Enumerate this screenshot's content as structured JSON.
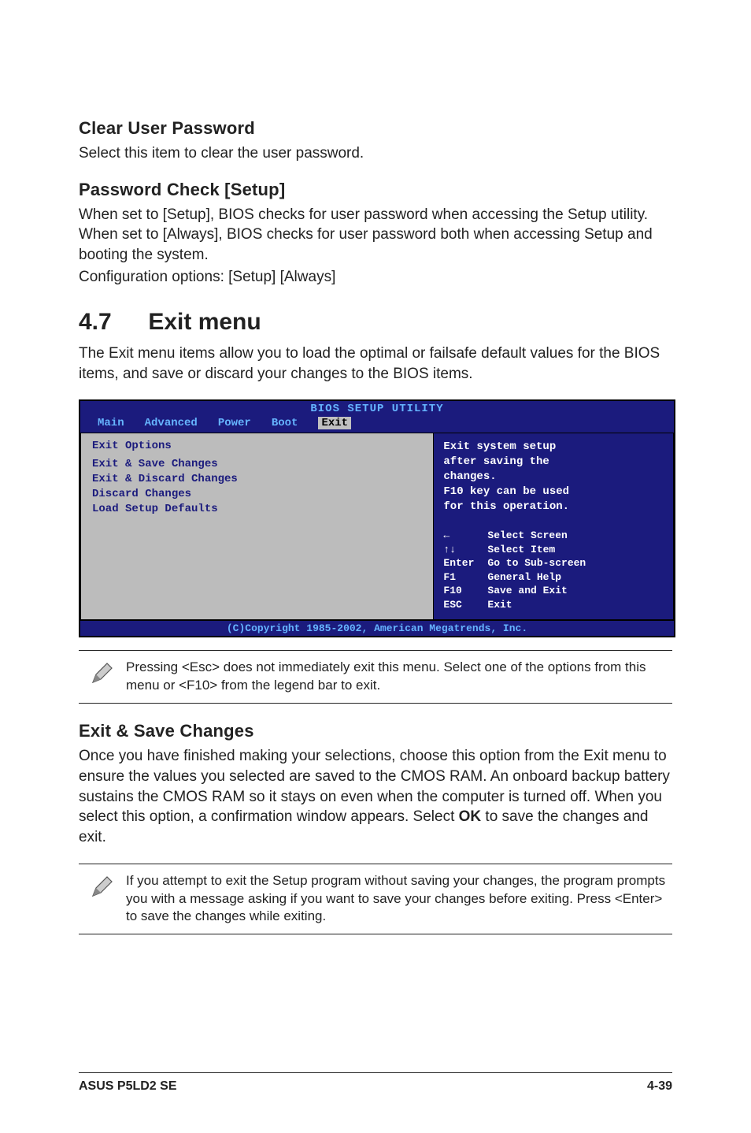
{
  "sections": {
    "clear_pw": {
      "title": "Clear User Password",
      "body": "Select this item to clear the user password."
    },
    "pw_check": {
      "title": "Password Check [Setup]",
      "body1": "When set to [Setup], BIOS checks for user password when accessing the Setup utility. When set to [Always], BIOS checks for user password both when accessing Setup and booting the system.",
      "body2": "Configuration options: [Setup] [Always]"
    },
    "exit_menu": {
      "num": "4.7",
      "title": "Exit menu",
      "body": "The Exit menu items allow you to load the optimal or failsafe default values for the BIOS items, and save or discard your changes to the BIOS items."
    },
    "exit_save": {
      "title": "Exit & Save Changes",
      "body_pre": "Once you have finished making your selections, choose this option from the Exit menu to ensure the values you selected are saved to the CMOS RAM. An onboard backup battery sustains the CMOS RAM so it stays on even when the computer is turned off. When you select this option, a confirmation window appears. Select ",
      "ok": "OK",
      "body_post": " to save the changes and exit."
    }
  },
  "bios": {
    "title": "BIOS SETUP UTILITY",
    "tabs": [
      "Main",
      "Advanced",
      "Power",
      "Boot",
      "Exit"
    ],
    "active_tab": "Exit",
    "left": {
      "heading": "Exit Options",
      "items": [
        "Exit & Save Changes",
        "Exit & Discard Changes",
        "Discard Changes",
        "",
        "Load Setup Defaults"
      ]
    },
    "right": {
      "hint": [
        "Exit system setup",
        "after saving the",
        "changes.",
        "",
        "F10 key can be used",
        "for this operation."
      ],
      "legend": [
        {
          "k": "←",
          "v": "Select Screen"
        },
        {
          "k": "↑↓",
          "v": "Select Item"
        },
        {
          "k": "Enter",
          "v": "Go to Sub-screen"
        },
        {
          "k": "F1",
          "v": "General Help"
        },
        {
          "k": "F10",
          "v": "Save and Exit"
        },
        {
          "k": "ESC",
          "v": "Exit"
        }
      ]
    },
    "footer": "(C)Copyright 1985-2002, American Megatrends, Inc."
  },
  "note1": "Pressing <Esc> does not immediately exit this menu. Select one of the options from this menu or <F10> from the legend bar to exit.",
  "note2": "If you attempt to exit the Setup program without saving your changes, the program prompts you with a message asking if you want to save your changes before exiting. Press <Enter> to save the changes while exiting.",
  "footer": {
    "left": "ASUS P5LD2 SE",
    "right": "4-39"
  }
}
